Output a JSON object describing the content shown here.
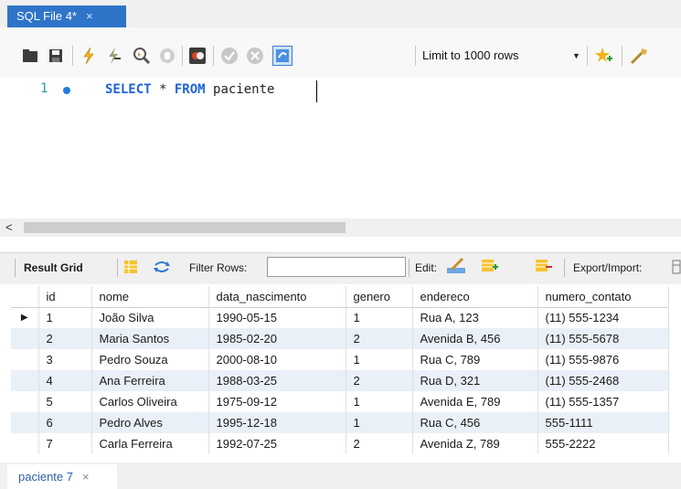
{
  "editor_tab": {
    "title": "SQL File 4*",
    "close": "×"
  },
  "toolbar": {
    "limit_label": "Limit to 1000 rows",
    "icons": [
      "folder-open-icon",
      "save-icon",
      "execute-icon",
      "execute-line-icon",
      "explain-icon",
      "stop-icon",
      "toggle-autocommit-icon",
      "commit-icon",
      "rollback-icon",
      "toggle-icon",
      "dropdown-arrow-icon",
      "bookmark-icon",
      "beautify-icon"
    ]
  },
  "editor": {
    "line_number": "1",
    "code_keyword1": "SELECT",
    "code_star": " * ",
    "code_keyword2": "FROM",
    "code_table": " paciente"
  },
  "result_toolbar": {
    "result_grid": "Result Grid",
    "filter_rows": "Filter Rows:",
    "edit": "Edit:",
    "export_import": "Export/Import:"
  },
  "grid": {
    "columns": [
      "id",
      "nome",
      "data_nascimento",
      "genero",
      "endereco",
      "numero_contato"
    ],
    "rows": [
      [
        "1",
        "João Silva",
        "1990-05-15",
        "1",
        "Rua A, 123",
        "(11) 555-1234"
      ],
      [
        "2",
        "Maria Santos",
        "1985-02-20",
        "2",
        "Avenida B, 456",
        "(11) 555-5678"
      ],
      [
        "3",
        "Pedro Souza",
        "2000-08-10",
        "1",
        "Rua C, 789",
        "(11) 555-9876"
      ],
      [
        "4",
        "Ana Ferreira",
        "1988-03-25",
        "2",
        "Rua D, 321",
        "(11) 555-2468"
      ],
      [
        "5",
        "Carlos Oliveira",
        "1975-09-12",
        "1",
        "Avenida E, 789",
        "(11) 555-1357"
      ],
      [
        "6",
        "Pedro Alves",
        "1995-12-18",
        "1",
        "Rua C, 456",
        "555-1111"
      ],
      [
        "7",
        "Carla Ferreira",
        "1992-07-25",
        "2",
        "Avenida Z, 789",
        "555-2222"
      ]
    ]
  },
  "bottom_tab": {
    "title": "paciente 7",
    "close": "×"
  }
}
